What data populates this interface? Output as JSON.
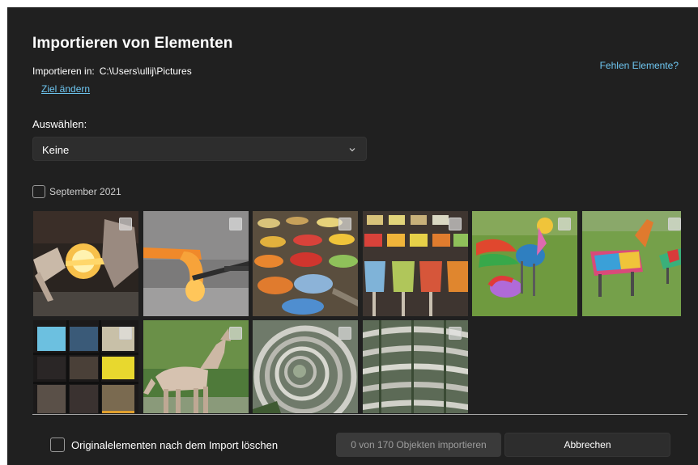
{
  "dialog": {
    "title": "Importieren von Elementen",
    "import_label": "Importieren in:",
    "import_path": "C:\\Users\\ullij\\Pictures",
    "change_target": "Ziel ändern",
    "missing_items": "Fehlen Elemente?",
    "select_label": "Auswählen:",
    "select_value": "Keine"
  },
  "group": {
    "label": "September 2021",
    "checked": false
  },
  "photos": [
    {
      "subject": "glass blowing with glowing orange glass",
      "checked": false
    },
    {
      "subject": "hot glowing glass on metal rod",
      "checked": false
    },
    {
      "subject": "colorful glass powder scoops",
      "checked": false
    },
    {
      "subject": "colorful glass powder trays",
      "checked": false
    },
    {
      "subject": "colorful glass bird sculpture on grass",
      "checked": false
    },
    {
      "subject": "colorful glass animal sculptures on grass",
      "checked": false
    },
    {
      "subject": "glass window panels dark and yellow",
      "checked": false
    },
    {
      "subject": "howling wolf in enclosure",
      "checked": false
    },
    {
      "subject": "spiral wooden tower",
      "checked": false
    },
    {
      "subject": "tiered wooden tower interior",
      "checked": false
    }
  ],
  "footer": {
    "delete_originals_label": "Originalelementen nach dem Import löschen",
    "import_button": "0 von 170 Objekten importieren",
    "cancel_button": "Abbrechen"
  },
  "colors": {
    "background": "#202020",
    "link": "#6ec6f1",
    "control": "#2d2d2d"
  }
}
